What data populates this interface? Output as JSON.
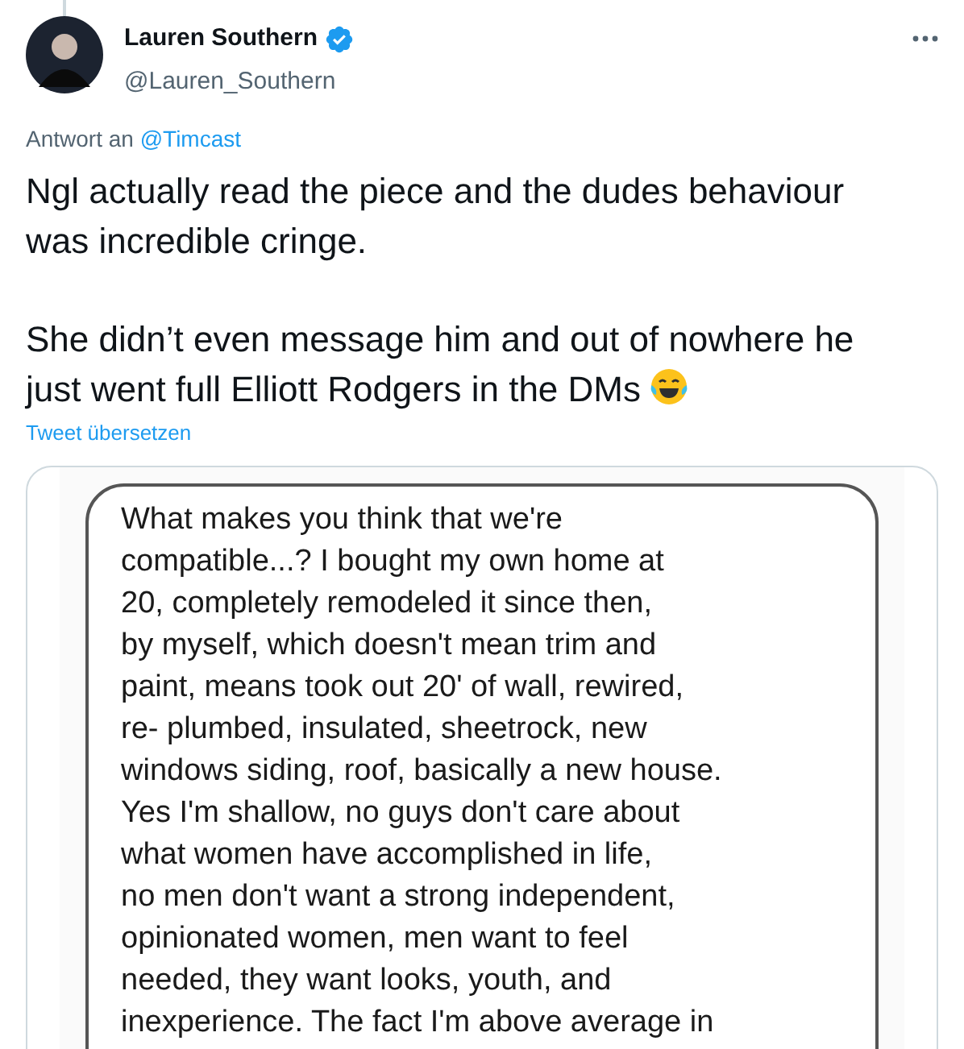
{
  "author": {
    "name": "Lauren Southern",
    "verified": true,
    "handle": "@Lauren_Southern"
  },
  "reply_to": {
    "prefix": "Antwort an",
    "mention": "@Timcast"
  },
  "tweet_paragraphs": [
    [
      "Ngl actually read the piece and the dudes behaviour",
      "was incredible cringe."
    ],
    [
      "She didn’t even message him and out of nowhere he",
      "just went full Elliott Rodgers in the DMs"
    ]
  ],
  "translate_link": "Tweet übersetzen",
  "attached_image": {
    "message_lines": [
      "What makes you think that we're",
      "compatible...? I bought my own home at",
      "20, completely remodeled it since then,",
      "by myself, which doesn't mean trim and",
      "paint, means took out 20' of wall, rewired,",
      "re- plumbed, insulated, sheetrock, new",
      "windows siding, roof, basically a new house.",
      "Yes I'm shallow, no guys don't care about",
      "what women have accomplished in life,",
      "no men don't want a strong independent,",
      "opinionated women, men want to feel",
      "needed, they want looks, youth, and",
      "inexperience. The fact I'm above average in"
    ]
  }
}
